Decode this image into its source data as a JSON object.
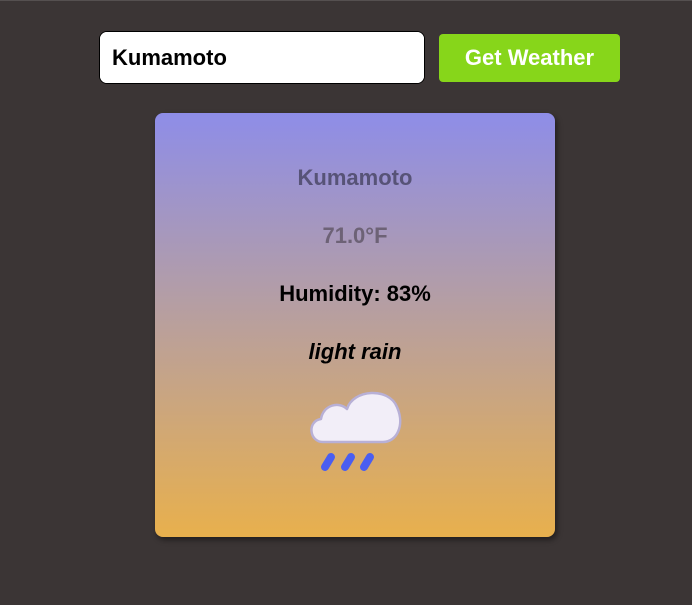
{
  "search": {
    "value": "Kumamoto",
    "button_label": "Get Weather"
  },
  "weather": {
    "city": "Kumamoto",
    "temperature": "71.0°F",
    "humidity": "Humidity: 83%",
    "description": "light rain",
    "icon": "rain-cloud-icon"
  },
  "colors": {
    "background": "#3b3535",
    "button": "#87d61a",
    "card_gradient_top": "#8e8de8",
    "card_gradient_bottom": "#e8b04d",
    "rain_drops": "#4a5ef0"
  }
}
